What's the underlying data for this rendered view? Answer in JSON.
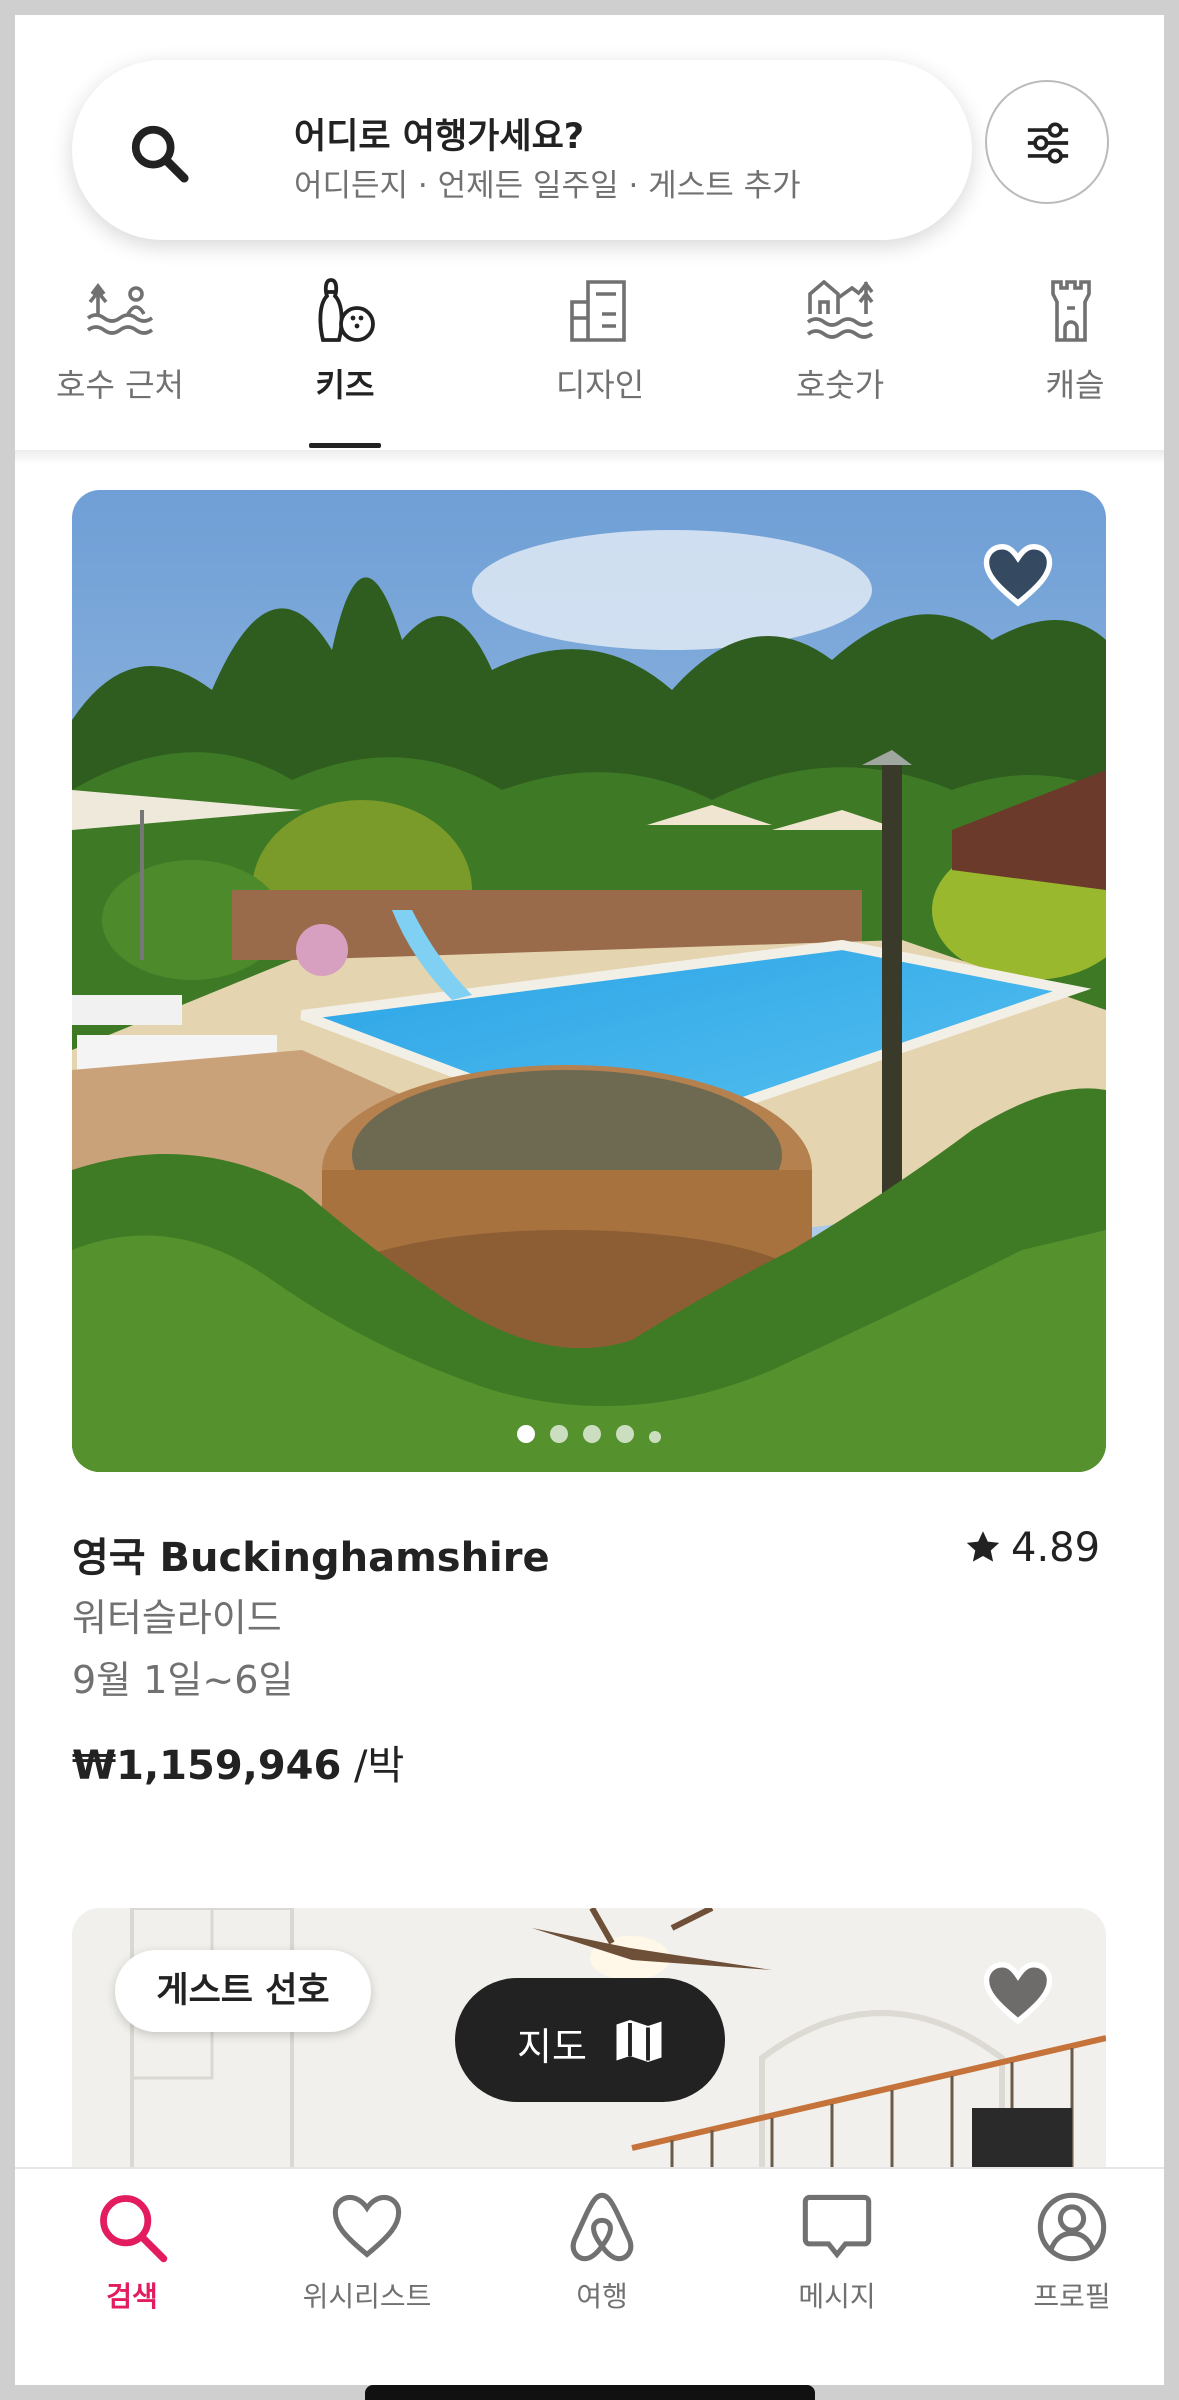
{
  "search": {
    "title": "어디로 여행가세요?",
    "subtitle": "어디든지 · 언제든 일주일 · 게스트 추가",
    "search_icon": "search-icon",
    "filter_icon": "filter-sliders-icon"
  },
  "categories": {
    "items": [
      {
        "label": "호수 근처",
        "icon": "lake-icon"
      },
      {
        "label": "키즈",
        "icon": "bowling-icon",
        "selected": true
      },
      {
        "label": "디자인",
        "icon": "design-building-icon"
      },
      {
        "label": "호숫가",
        "icon": "lakefront-icon"
      },
      {
        "label": "캐슬",
        "icon": "castle-icon"
      }
    ]
  },
  "listing": {
    "title": "영국 Buckinghamshire",
    "rating": "4.89",
    "description": "워터슬라이드",
    "dates": "9월 1일~6일",
    "price": "₩1,159,946",
    "price_unit": " /박",
    "photo_count": 5,
    "active_photo": 1
  },
  "listing2": {
    "badge": "게스트 선호"
  },
  "map_button": {
    "label": "지도",
    "icon": "map-icon"
  },
  "tabbar": {
    "items": [
      {
        "label": "검색",
        "icon": "search-icon",
        "active": true
      },
      {
        "label": "위시리스트",
        "icon": "heart-icon"
      },
      {
        "label": "여행",
        "icon": "airbnb-logo-icon"
      },
      {
        "label": "메시지",
        "icon": "message-icon"
      },
      {
        "label": "프로필",
        "icon": "profile-icon"
      }
    ]
  },
  "colors": {
    "accent": "#e31c5f",
    "text": "#222222",
    "muted": "#717171"
  }
}
